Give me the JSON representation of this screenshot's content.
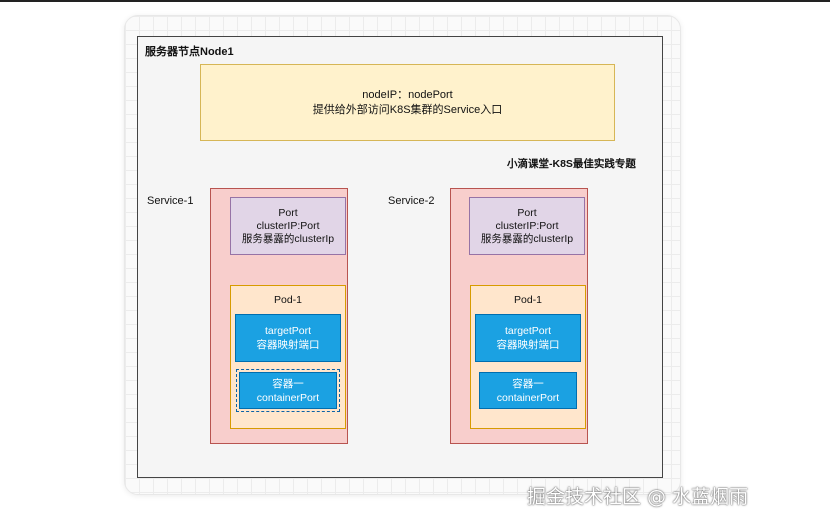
{
  "node": {
    "title": "服务器节点Node1",
    "entry_line1": "nodeIP：nodePort",
    "entry_line2": "提供给外部访问K8S集群的Service入口"
  },
  "subject_label": "小滴课堂-K8S最佳实践专题",
  "services": [
    {
      "label": "Service-1",
      "port_line1": "Port",
      "port_line2": "clusterIP:Port",
      "port_line3": "服务暴露的clusterIp",
      "pod_title": "Pod-1",
      "target_line1": "targetPort",
      "target_line2": "容器映射端口",
      "container_line1": "容器一",
      "container_line2": "containerPort"
    },
    {
      "label": "Service-2",
      "port_line1": "Port",
      "port_line2": "clusterIP:Port",
      "port_line3": "服务暴露的clusterIp",
      "pod_title": "Pod-1",
      "target_line1": "targetPort",
      "target_line2": "容器映射端口",
      "container_line1": "容器一",
      "container_line2": "containerPort"
    }
  ],
  "watermark": "掘金技术社区 @ 水蓝烟雨",
  "colors": {
    "entry_fill": "#fff2cc",
    "service_fill": "#f8cecc",
    "port_fill": "#e1d5e7",
    "pod_fill": "#ffe6cc",
    "container_fill": "#1ba1e2"
  }
}
